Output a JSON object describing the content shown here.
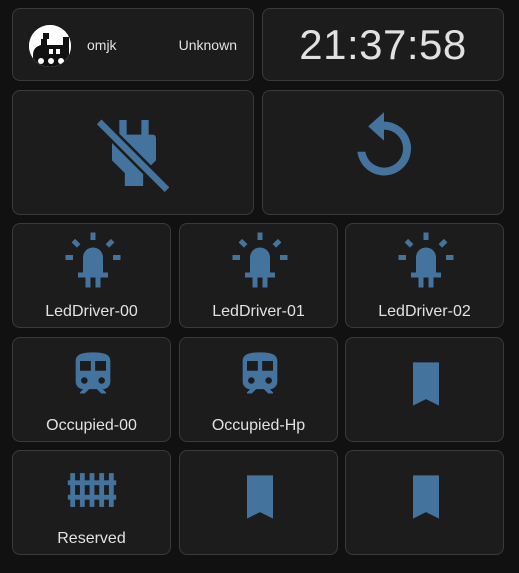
{
  "status": {
    "entity_name": "omjk",
    "state": "Unknown"
  },
  "clock": {
    "time": "21:37:58"
  },
  "top_buttons": [
    {
      "icon": "power-plug-off-icon"
    },
    {
      "icon": "restart-icon"
    }
  ],
  "grid": [
    {
      "label": "LedDriver-00",
      "icon": "led-icon"
    },
    {
      "label": "LedDriver-01",
      "icon": "led-icon"
    },
    {
      "label": "LedDriver-02",
      "icon": "led-icon"
    },
    {
      "label": "Occupied-00",
      "icon": "train-icon"
    },
    {
      "label": "Occupied-Hp",
      "icon": "train-icon"
    },
    {
      "label": "",
      "icon": "bookmark-icon"
    },
    {
      "label": "Reserved",
      "icon": "railway-track-icon"
    },
    {
      "label": "",
      "icon": "bookmark-icon"
    },
    {
      "label": "",
      "icon": "bookmark-icon"
    }
  ],
  "colors": {
    "background": "#111111",
    "card": "#1c1c1c",
    "card_border": "#3a3a3a",
    "icon": "#44739e",
    "text": "#e1e1e1"
  }
}
